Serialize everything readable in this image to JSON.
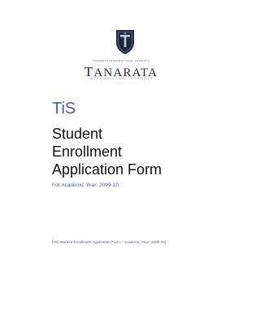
{
  "logo": {
    "crest_caption": "TANARATA INTERNATIONAL SCHOOLS",
    "name_first": "T",
    "name_rest": "ANARATA",
    "subtitle": "INTERNATIONAL SCHOOLS",
    "colors": {
      "navy": "#1c2742",
      "gray": "#7c7e86"
    }
  },
  "document": {
    "abbreviation": "TiS",
    "title_lines": [
      "Student",
      "Enrollment",
      "Application  Form"
    ],
    "academic_year": "For Academic Year:  2009-10.",
    "footer_marker": "—",
    "footer_text": "[TiS Student Enrollment Application Form – Academic Year: 2009-10]",
    "accent_color": "#4a5fa3"
  }
}
